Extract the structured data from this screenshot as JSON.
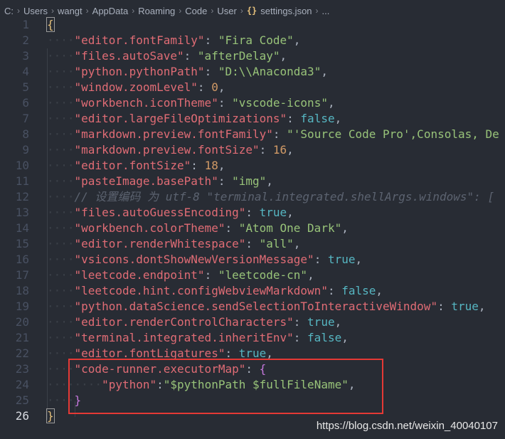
{
  "breadcrumb": {
    "items": [
      "C:",
      "Users",
      "wangt",
      "AppData",
      "Roaming",
      "Code",
      "User"
    ],
    "file_icon": "{}",
    "file_name": "settings.json",
    "ellipsis": "..."
  },
  "editor": {
    "active_line": 26,
    "lines": [
      {
        "n": "1",
        "segments": [
          {
            "t": "{",
            "c": "brace-y brace-box"
          }
        ]
      },
      {
        "n": "2",
        "segments": [
          {
            "t": "····",
            "c": "ws"
          },
          {
            "t": "\"editor.fontFamily\"",
            "c": "key"
          },
          {
            "t": ": ",
            "c": "punc"
          },
          {
            "t": "\"Fira Code\"",
            "c": "str"
          },
          {
            "t": ",",
            "c": "punc"
          }
        ]
      },
      {
        "n": "3",
        "segments": [
          {
            "t": "····",
            "c": "ws"
          },
          {
            "t": "\"files.autoSave\"",
            "c": "key"
          },
          {
            "t": ": ",
            "c": "punc"
          },
          {
            "t": "\"afterDelay\"",
            "c": "str"
          },
          {
            "t": ",",
            "c": "punc"
          }
        ]
      },
      {
        "n": "4",
        "segments": [
          {
            "t": "····",
            "c": "ws"
          },
          {
            "t": "\"python.pythonPath\"",
            "c": "key"
          },
          {
            "t": ": ",
            "c": "punc"
          },
          {
            "t": "\"D:\\\\Anaconda3\"",
            "c": "str"
          },
          {
            "t": ",",
            "c": "punc"
          }
        ]
      },
      {
        "n": "5",
        "segments": [
          {
            "t": "····",
            "c": "ws"
          },
          {
            "t": "\"window.zoomLevel\"",
            "c": "key"
          },
          {
            "t": ": ",
            "c": "punc"
          },
          {
            "t": "0",
            "c": "num"
          },
          {
            "t": ",",
            "c": "punc"
          }
        ]
      },
      {
        "n": "6",
        "segments": [
          {
            "t": "····",
            "c": "ws"
          },
          {
            "t": "\"workbench.iconTheme\"",
            "c": "key"
          },
          {
            "t": ": ",
            "c": "punc"
          },
          {
            "t": "\"vscode-icons\"",
            "c": "str"
          },
          {
            "t": ",",
            "c": "punc"
          }
        ]
      },
      {
        "n": "7",
        "segments": [
          {
            "t": "····",
            "c": "ws"
          },
          {
            "t": "\"editor.largeFileOptimizations\"",
            "c": "key"
          },
          {
            "t": ": ",
            "c": "punc"
          },
          {
            "t": "false",
            "c": "bool"
          },
          {
            "t": ",",
            "c": "punc"
          }
        ]
      },
      {
        "n": "8",
        "segments": [
          {
            "t": "····",
            "c": "ws"
          },
          {
            "t": "\"markdown.preview.fontFamily\"",
            "c": "key"
          },
          {
            "t": ": ",
            "c": "punc"
          },
          {
            "t": "\"'Source Code Pro',Consolas, De",
            "c": "str"
          }
        ]
      },
      {
        "n": "9",
        "segments": [
          {
            "t": "····",
            "c": "ws"
          },
          {
            "t": "\"markdown.preview.fontSize\"",
            "c": "key"
          },
          {
            "t": ": ",
            "c": "punc"
          },
          {
            "t": "16",
            "c": "num"
          },
          {
            "t": ",",
            "c": "punc"
          }
        ]
      },
      {
        "n": "10",
        "segments": [
          {
            "t": "····",
            "c": "ws"
          },
          {
            "t": "\"editor.fontSize\"",
            "c": "key"
          },
          {
            "t": ": ",
            "c": "punc"
          },
          {
            "t": "18",
            "c": "num"
          },
          {
            "t": ",",
            "c": "punc"
          }
        ]
      },
      {
        "n": "11",
        "segments": [
          {
            "t": "····",
            "c": "ws"
          },
          {
            "t": "\"pasteImage.basePath\"",
            "c": "key"
          },
          {
            "t": ": ",
            "c": "punc"
          },
          {
            "t": "\"img\"",
            "c": "str"
          },
          {
            "t": ",",
            "c": "punc"
          }
        ]
      },
      {
        "n": "12",
        "segments": [
          {
            "t": "····",
            "c": "ws"
          },
          {
            "t": "// 设置编码 为 utf-8 \"terminal.integrated.shellArgs.windows\": [",
            "c": "comment"
          }
        ]
      },
      {
        "n": "13",
        "segments": [
          {
            "t": "····",
            "c": "ws"
          },
          {
            "t": "\"files.autoGuessEncoding\"",
            "c": "key"
          },
          {
            "t": ": ",
            "c": "punc"
          },
          {
            "t": "true",
            "c": "bool"
          },
          {
            "t": ",",
            "c": "punc"
          }
        ]
      },
      {
        "n": "14",
        "segments": [
          {
            "t": "····",
            "c": "ws"
          },
          {
            "t": "\"workbench.colorTheme\"",
            "c": "key"
          },
          {
            "t": ": ",
            "c": "punc"
          },
          {
            "t": "\"Atom One Dark\"",
            "c": "str"
          },
          {
            "t": ",",
            "c": "punc"
          }
        ]
      },
      {
        "n": "15",
        "segments": [
          {
            "t": "····",
            "c": "ws"
          },
          {
            "t": "\"editor.renderWhitespace\"",
            "c": "key"
          },
          {
            "t": ": ",
            "c": "punc"
          },
          {
            "t": "\"all\"",
            "c": "str"
          },
          {
            "t": ",",
            "c": "punc"
          }
        ]
      },
      {
        "n": "16",
        "segments": [
          {
            "t": "····",
            "c": "ws"
          },
          {
            "t": "\"vsicons.dontShowNewVersionMessage\"",
            "c": "key"
          },
          {
            "t": ": ",
            "c": "punc"
          },
          {
            "t": "true",
            "c": "bool"
          },
          {
            "t": ",",
            "c": "punc"
          }
        ]
      },
      {
        "n": "17",
        "segments": [
          {
            "t": "····",
            "c": "ws"
          },
          {
            "t": "\"leetcode.endpoint\"",
            "c": "key"
          },
          {
            "t": ": ",
            "c": "punc"
          },
          {
            "t": "\"leetcode-cn\"",
            "c": "str"
          },
          {
            "t": ",",
            "c": "punc"
          }
        ]
      },
      {
        "n": "18",
        "segments": [
          {
            "t": "····",
            "c": "ws"
          },
          {
            "t": "\"leetcode.hint.configWebviewMarkdown\"",
            "c": "key"
          },
          {
            "t": ": ",
            "c": "punc"
          },
          {
            "t": "false",
            "c": "bool"
          },
          {
            "t": ",",
            "c": "punc"
          }
        ]
      },
      {
        "n": "19",
        "segments": [
          {
            "t": "····",
            "c": "ws"
          },
          {
            "t": "\"python.dataScience.sendSelectionToInteractiveWindow\"",
            "c": "key"
          },
          {
            "t": ": ",
            "c": "punc"
          },
          {
            "t": "true",
            "c": "bool"
          },
          {
            "t": ",",
            "c": "punc"
          }
        ]
      },
      {
        "n": "20",
        "segments": [
          {
            "t": "····",
            "c": "ws"
          },
          {
            "t": "\"editor.renderControlCharacters\"",
            "c": "key"
          },
          {
            "t": ": ",
            "c": "punc"
          },
          {
            "t": "true",
            "c": "bool"
          },
          {
            "t": ",",
            "c": "punc"
          }
        ]
      },
      {
        "n": "21",
        "segments": [
          {
            "t": "····",
            "c": "ws"
          },
          {
            "t": "\"terminal.integrated.inheritEnv\"",
            "c": "key"
          },
          {
            "t": ": ",
            "c": "punc"
          },
          {
            "t": "false",
            "c": "bool"
          },
          {
            "t": ",",
            "c": "punc"
          }
        ]
      },
      {
        "n": "22",
        "segments": [
          {
            "t": "····",
            "c": "ws"
          },
          {
            "t": "\"editor.fontLigatures\"",
            "c": "key"
          },
          {
            "t": ": ",
            "c": "punc"
          },
          {
            "t": "true",
            "c": "bool"
          },
          {
            "t": ",",
            "c": "punc"
          }
        ]
      },
      {
        "n": "23",
        "segments": [
          {
            "t": "····",
            "c": "ws"
          },
          {
            "t": "\"code-runner.executorMap\"",
            "c": "key"
          },
          {
            "t": ": ",
            "c": "punc"
          },
          {
            "t": "{",
            "c": "brace-p"
          }
        ]
      },
      {
        "n": "24",
        "segments": [
          {
            "t": "····",
            "c": "ws"
          },
          {
            "t": "····",
            "c": "ws"
          },
          {
            "t": "\"python\"",
            "c": "key"
          },
          {
            "t": ":",
            "c": "punc"
          },
          {
            "t": "\"$pythonPath $fullFileName\"",
            "c": "str"
          },
          {
            "t": ",",
            "c": "punc"
          }
        ]
      },
      {
        "n": "25",
        "segments": [
          {
            "t": "····",
            "c": "ws"
          },
          {
            "t": "}",
            "c": "brace-p"
          }
        ]
      },
      {
        "n": "26",
        "segments": [
          {
            "t": "}",
            "c": "brace-y brace-box"
          }
        ]
      }
    ]
  },
  "watermark": "https://blog.csdn.net/weixin_40040107",
  "colors": {
    "background": "#282c34",
    "key": "#e06c75",
    "string": "#98c379",
    "number": "#d19a66",
    "boolean": "#56b6c2",
    "comment": "#5c6370",
    "highlight_box": "#e53935"
  }
}
